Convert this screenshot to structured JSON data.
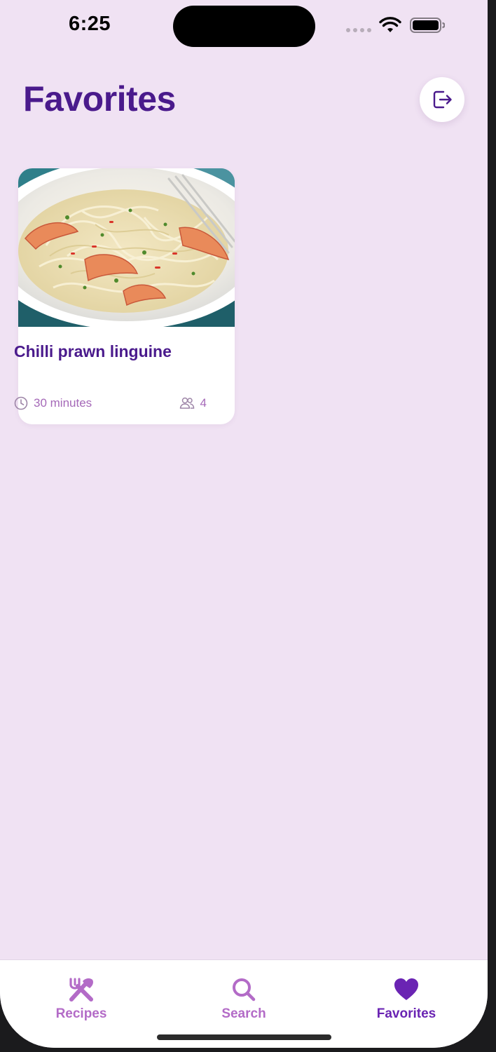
{
  "status_bar": {
    "time": "6:25"
  },
  "header": {
    "title": "Favorites",
    "logout_icon": "logout-icon"
  },
  "favorites": [
    {
      "title": "Chilli prawn linguine",
      "time": "30 minutes",
      "servings": "4",
      "time_icon": "clock-icon",
      "servings_icon": "people-icon"
    }
  ],
  "tab_bar": {
    "items": [
      {
        "label": "Recipes",
        "icon": "utensils-icon",
        "active": false
      },
      {
        "label": "Search",
        "icon": "search-icon",
        "active": false
      },
      {
        "label": "Favorites",
        "icon": "heart-icon",
        "active": true
      }
    ]
  },
  "colors": {
    "background": "#f0e2f3",
    "primary": "#4a1a8c",
    "accent": "#a569b8",
    "tab_inactive": "#b36bc7",
    "tab_active": "#6a24b3"
  }
}
